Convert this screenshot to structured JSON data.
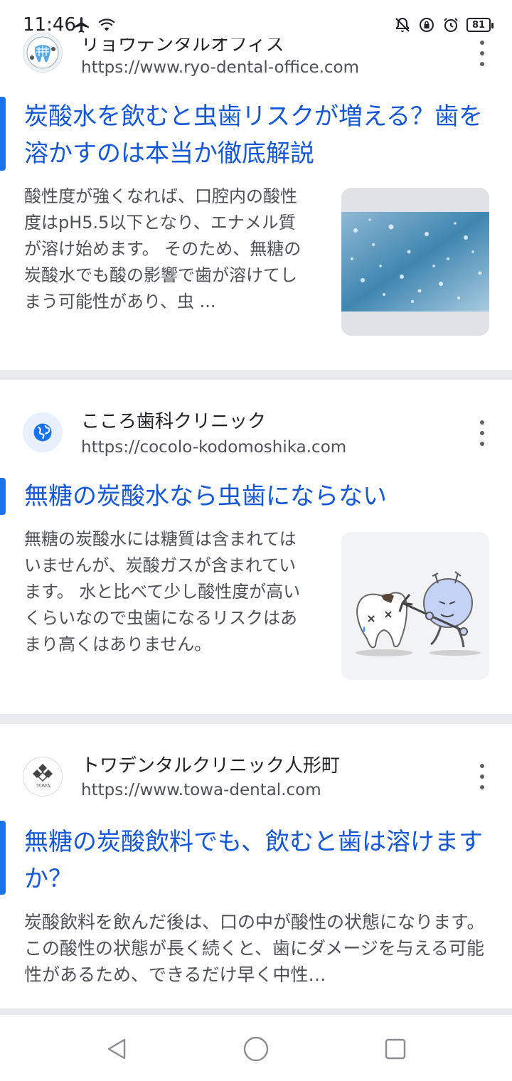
{
  "status_bar": {
    "time": "11:46",
    "battery": "81",
    "left_icons": [
      "airplane-icon",
      "wifi-icon"
    ],
    "right_icons": [
      "bell-off-icon",
      "lock-rotate-icon",
      "alarm-icon",
      "battery-icon"
    ]
  },
  "results": [
    {
      "site_name": "リョウデンタルオフィス",
      "url": "https://www.ryo-dental-office.com",
      "title": "炭酸水を飲むと虫歯リスクが増える？歯を溶かすのは本当か徹底解説",
      "snippet": "酸性度が強くなれば、口腔内の酸性度はpH5.5以下となり、エナメル質が溶け始めます。 そのため、無糖の炭酸水でも酸の影響で歯が溶けてしまう可能性があり、虫 ...",
      "thumbnail": "sparkling-water-image"
    },
    {
      "site_name": "こころ歯科クリニック",
      "url": "https://cocolo-kodomoshika.com",
      "title": "無糖の炭酸水なら虫歯にならない",
      "snippet": "無糖の炭酸水には糖質は含まれてはいませんが、炭酸ガスが含まれています。 水と比べて少し酸性度が高いくらいなので虫歯になるリスクはあまり高くはありません。",
      "thumbnail": "tooth-and-germ-illustration"
    },
    {
      "site_name": "トワデンタルクリニック人形町",
      "url": "https://www.towa-dental.com",
      "title": "無糖の炭酸飲料でも、飲むと歯は溶けますか？",
      "snippet": "炭酸飲料を飲んだ後は、口の中が酸性の状態になります。この酸性の状態が長く続くと、歯にダメージを与える可能性があるため、できるだけ早く中性…",
      "logo_text": "TOWA"
    }
  ],
  "colors": {
    "title": "#1558d6",
    "accent": "#1a73e8",
    "snippet": "#4d5156",
    "divider": "#e8eaed"
  },
  "nav": [
    "back-icon",
    "home-icon",
    "recents-icon"
  ]
}
